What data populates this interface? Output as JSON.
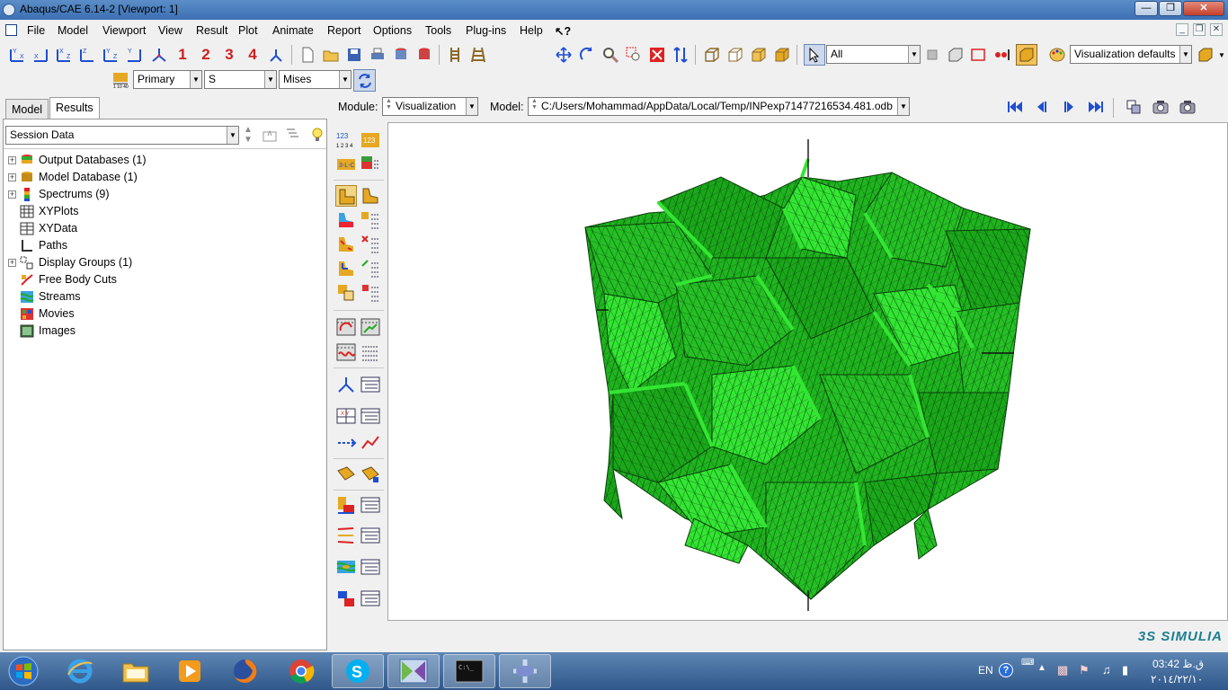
{
  "window": {
    "title": "Abaqus/CAE 6.14-2 [Viewport: 1]"
  },
  "menu": [
    "File",
    "Model",
    "Viewport",
    "View",
    "Result",
    "Plot",
    "Animate",
    "Report",
    "Options",
    "Tools",
    "Plug-ins",
    "Help",
    "↖?"
  ],
  "toolbar": {
    "viewport_numbers": [
      "1",
      "2",
      "3",
      "4"
    ],
    "selection_filter": "All",
    "visualization": "Visualization defaults",
    "field_output": {
      "step": "Primary",
      "variable": "S",
      "invariant": "Mises"
    }
  },
  "tabs": [
    "Model",
    "Results"
  ],
  "session_combo": "Session Data",
  "tree": [
    {
      "label": "Output Databases (1)",
      "expandable": true
    },
    {
      "label": "Model Database (1)",
      "expandable": true
    },
    {
      "label": "Spectrums (9)",
      "expandable": true
    },
    {
      "label": "XYPlots",
      "expandable": false
    },
    {
      "label": "XYData",
      "expandable": false
    },
    {
      "label": "Paths",
      "expandable": false
    },
    {
      "label": "Display Groups (1)",
      "expandable": true
    },
    {
      "label": "Free Body Cuts",
      "expandable": false
    },
    {
      "label": "Streams",
      "expandable": false
    },
    {
      "label": "Movies",
      "expandable": false
    },
    {
      "label": "Images",
      "expandable": false
    }
  ],
  "module_bar": {
    "module_label": "Module:",
    "module_value": "Visualization",
    "model_label": "Model:",
    "model_value": "C:/Users/Mohammad/AppData/Local/Temp/INPexp71477216534.481.odb"
  },
  "colors": {
    "mesh_green": "#1fb51f",
    "mesh_light": "#33e633",
    "mesh_edge": "#0a3d0a"
  },
  "brand": "3S SIMULIA",
  "taskbar": {
    "apps": [
      "start",
      "internet-explorer",
      "file-explorer",
      "media-player",
      "firefox",
      "chrome",
      "skype",
      "abaqus",
      "command-prompt",
      "abaqus-cae"
    ],
    "lang": "EN",
    "time": "03:42 ق.ظ",
    "date": "٢٠١٤/٢٢/١٠"
  }
}
